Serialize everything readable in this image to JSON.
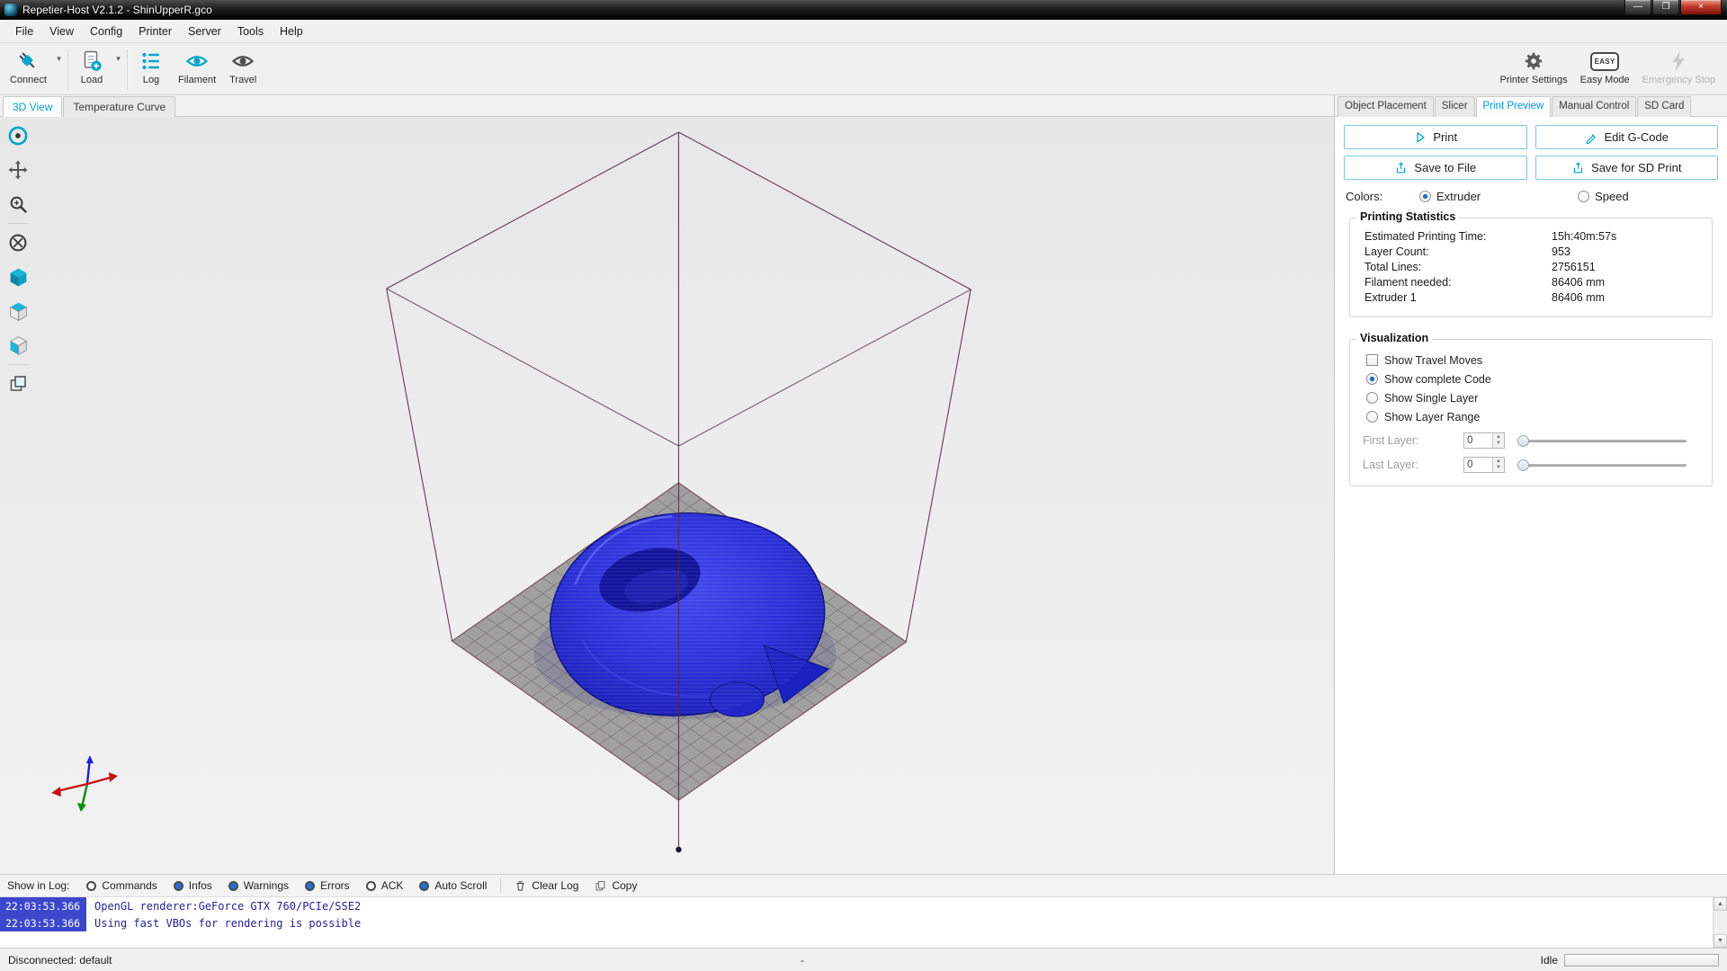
{
  "colors": {
    "accent": "#00a5c7",
    "active_tab": "#0095d6",
    "model_blue": "#2a2fd4",
    "wireframe": "#54284e",
    "log_timestamp_bg": "#3b48cc",
    "log_text": "#23238e",
    "close_button": "#c0392b"
  },
  "titlebar": {
    "title": "Repetier-Host V2.1.2 - ShinUpperR.gco"
  },
  "menubar": {
    "items": [
      {
        "label": "File"
      },
      {
        "label": "View"
      },
      {
        "label": "Config"
      },
      {
        "label": "Printer"
      },
      {
        "label": "Server"
      },
      {
        "label": "Tools"
      },
      {
        "label": "Help"
      }
    ]
  },
  "toolbar": {
    "connect": {
      "label": "Connect"
    },
    "load": {
      "label": "Load"
    },
    "log": {
      "label": "Log"
    },
    "filament": {
      "label": "Filament"
    },
    "travel": {
      "label": "Travel"
    },
    "printer_settings": {
      "label": "Printer Settings"
    },
    "easy_mode": {
      "label": "Easy Mode",
      "badge": "EASY"
    },
    "emergency_stop": {
      "label": "Emergency Stop"
    }
  },
  "view_tabs": [
    {
      "label": "3D View",
      "active": true
    },
    {
      "label": "Temperature Curve",
      "active": false
    }
  ],
  "right_tabs": [
    {
      "label": "Object Placement",
      "active": false
    },
    {
      "label": "Slicer",
      "active": false
    },
    {
      "label": "Print Preview",
      "active": true
    },
    {
      "label": "Manual Control",
      "active": false
    },
    {
      "label": "SD Card",
      "active": false
    }
  ],
  "preview_panel": {
    "buttons": {
      "print": "Print",
      "edit_gcode": "Edit G-Code",
      "save_to_file": "Save to File",
      "save_for_sd": "Save for SD Print"
    },
    "colors_row": {
      "label": "Colors:",
      "options": [
        {
          "label": "Extruder",
          "selected": true
        },
        {
          "label": "Speed",
          "selected": false
        }
      ]
    },
    "statistics": {
      "title": "Printing Statistics",
      "rows": [
        {
          "label": "Estimated Printing Time:",
          "value": "15h:40m:57s"
        },
        {
          "label": "Layer Count:",
          "value": "953"
        },
        {
          "label": "Total Lines:",
          "value": "2756151"
        },
        {
          "label": "Filament needed:",
          "value": "86406 mm"
        },
        {
          "label": "Extruder 1",
          "value": "86406 mm"
        }
      ]
    },
    "visualization": {
      "title": "Visualization",
      "options": [
        {
          "type": "checkbox",
          "label": "Show Travel Moves",
          "checked": false
        },
        {
          "type": "radio",
          "label": "Show complete Code",
          "checked": true
        },
        {
          "type": "radio",
          "label": "Show Single Layer",
          "checked": false
        },
        {
          "type": "radio",
          "label": "Show Layer Range",
          "checked": false
        }
      ],
      "first_layer": {
        "label": "First Layer:",
        "value": "0"
      },
      "last_layer": {
        "label": "Last Layer:",
        "value": "0"
      }
    }
  },
  "log_toolbar": {
    "label": "Show in Log:",
    "toggles": [
      {
        "label": "Commands",
        "active": false
      },
      {
        "label": "Infos",
        "active": true
      },
      {
        "label": "Warnings",
        "active": true
      },
      {
        "label": "Errors",
        "active": true
      },
      {
        "label": "ACK",
        "active": false
      },
      {
        "label": "Auto Scroll",
        "active": true
      }
    ],
    "clear_log": "Clear Log",
    "copy": "Copy"
  },
  "log": {
    "entries": [
      {
        "time": "22:03:53.366",
        "message": "OpenGL renderer:GeForce GTX 760/PCIe/SSE2"
      },
      {
        "time": "22:03:53.366",
        "message": "Using fast VBOs for rendering is possible"
      }
    ]
  },
  "statusbar": {
    "connection": "Disconnected: default",
    "center": "-",
    "state": "Idle"
  },
  "icons": {
    "dropdown_arrow": "▾",
    "minimize": "—",
    "maximize": "❐",
    "close": "×",
    "spin_up": "▲",
    "spin_down": "▼",
    "scroll_up": "▲",
    "scroll_down": "▼"
  }
}
